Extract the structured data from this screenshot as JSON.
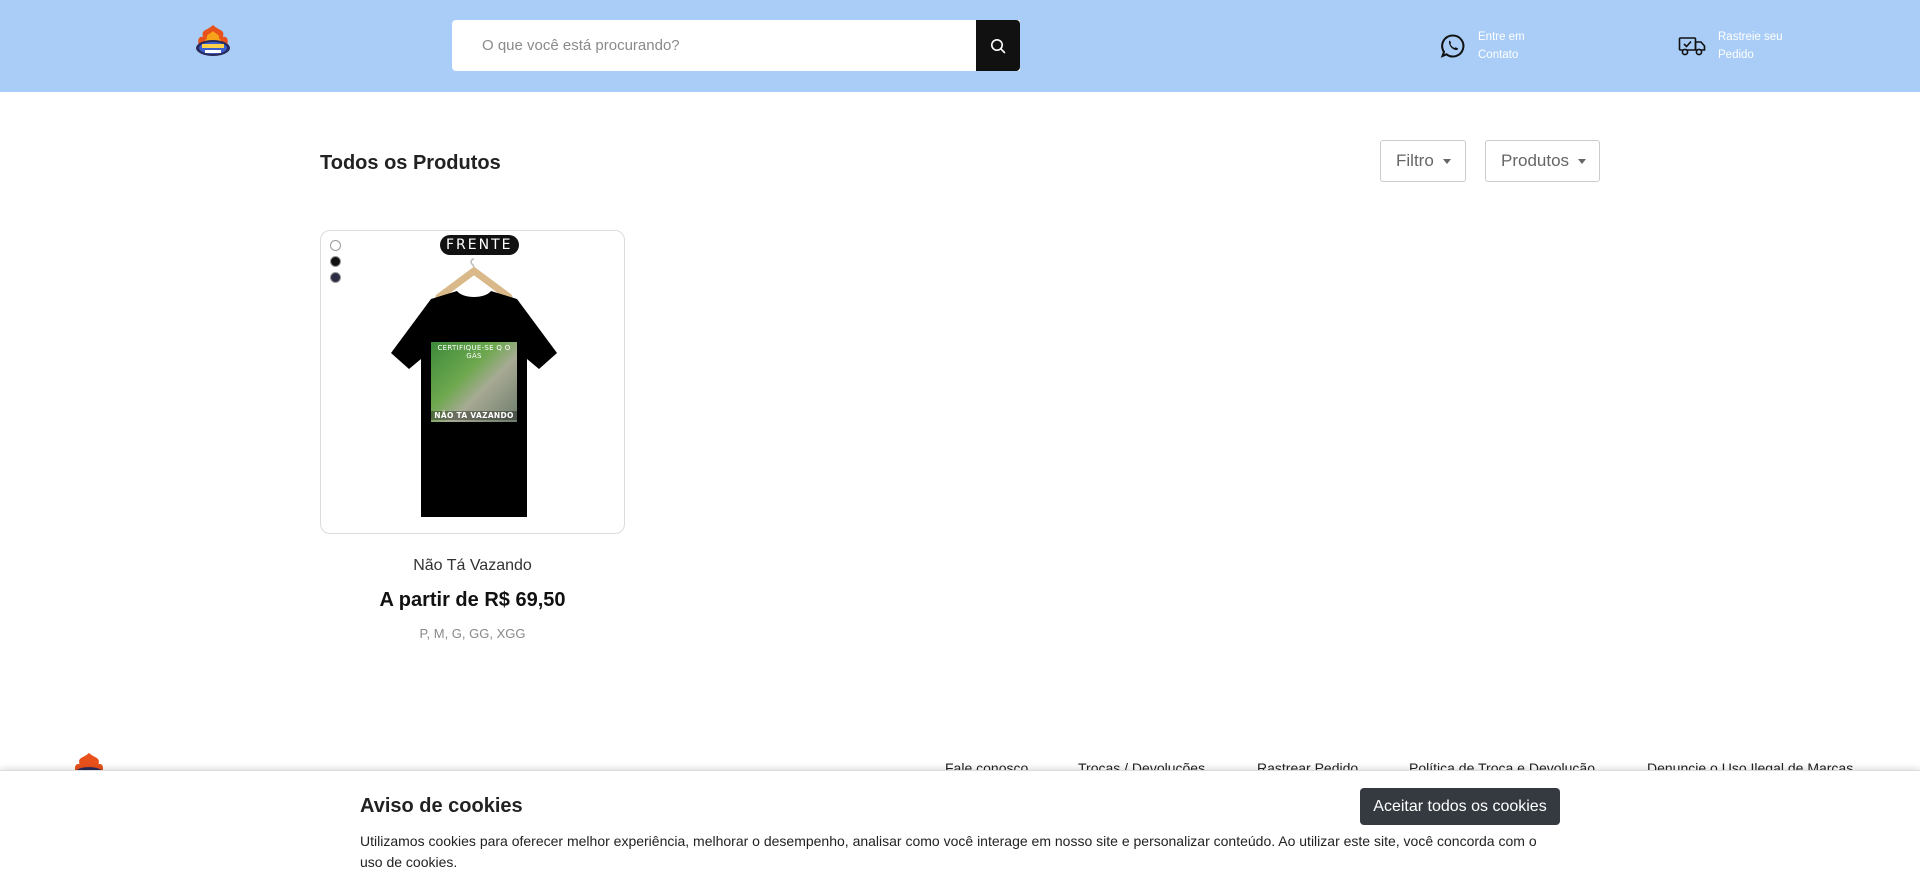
{
  "header": {
    "logo_alt": "Bangbi Store",
    "search": {
      "placeholder": "O que você está procurando?",
      "value": ""
    },
    "contact": {
      "line1": "Entre em",
      "line2": "Contato"
    },
    "track": {
      "line1": "Rastreie seu",
      "line2": "Pedido"
    }
  },
  "main": {
    "title": "Todos os Produtos",
    "filter_label": "Filtro",
    "products_label": "Produtos",
    "products": [
      {
        "name": "Não Tá Vazando",
        "price": "A partir de R$ 69,50",
        "sizes": "P, M, G, GG, XGG",
        "view_tag": "FRENTE",
        "print_top": "CERTIFIQUE-SE Q O GÁS",
        "print_bottom": "NÃO TA VAZANDO",
        "swatches": [
          "#ffffff",
          "#111111",
          "#2b2d42"
        ]
      }
    ]
  },
  "footer": {
    "links": [
      "Fale conosco",
      "Trocas / Devoluções",
      "Rastrear Pedido",
      "Política de Troca e Devolução",
      "Denuncie o Uso Ilegal de Marcas"
    ]
  },
  "cookie": {
    "title": "Aviso de cookies",
    "text": "Utilizamos cookies para oferecer melhor experiência, melhorar o desempenho, analisar como você interage em nosso site e personalizar conteúdo. Ao utilizar este site, você concorda com o uso de cookies.",
    "accept_label": "Aceitar todos os cookies"
  },
  "colors": {
    "header_bg": "#a9cdf6",
    "search_button": "#111111",
    "cookie_button": "#343a40"
  }
}
